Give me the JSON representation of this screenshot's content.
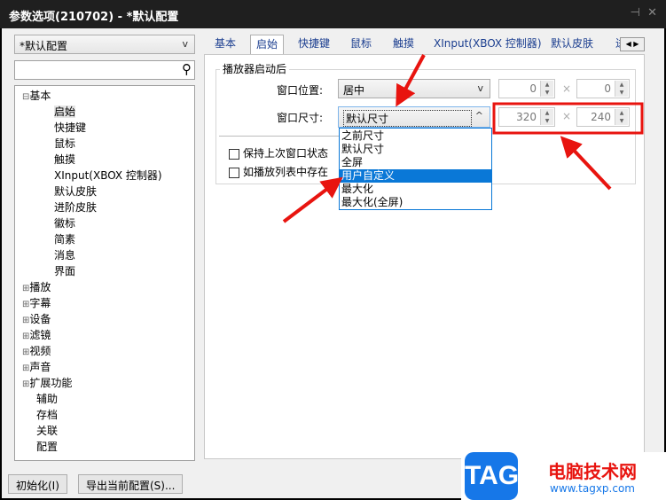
{
  "window": {
    "title": "参数选项(210702) - *默认配置",
    "pin_icon": "pin-icon",
    "close_icon": "close-icon"
  },
  "profile": {
    "selected": "*默认配置",
    "caret": "v"
  },
  "search": {
    "value": "",
    "icon": "search-icon"
  },
  "tree": [
    {
      "label": "基本",
      "level": 0,
      "expander": "⊟"
    },
    {
      "label": "启始",
      "level": 1,
      "selected": true
    },
    {
      "label": "快捷键",
      "level": 1
    },
    {
      "label": "鼠标",
      "level": 1
    },
    {
      "label": "触摸",
      "level": 1
    },
    {
      "label": "XInput(XBOX 控制器)",
      "level": 1
    },
    {
      "label": "默认皮肤",
      "level": 1
    },
    {
      "label": "进阶皮肤",
      "level": 1
    },
    {
      "label": "徽标",
      "level": 1
    },
    {
      "label": "简素",
      "level": 1
    },
    {
      "label": "消息",
      "level": 1
    },
    {
      "label": "界面",
      "level": 1
    },
    {
      "label": "播放",
      "level": 0,
      "expander": "⊞"
    },
    {
      "label": "字幕",
      "level": 0,
      "expander": "⊞"
    },
    {
      "label": "设备",
      "level": 0,
      "expander": "⊞"
    },
    {
      "label": "滤镜",
      "level": 0,
      "expander": "⊞"
    },
    {
      "label": "视频",
      "level": 0,
      "expander": "⊞"
    },
    {
      "label": "声音",
      "level": 0,
      "expander": "⊞"
    },
    {
      "label": "扩展功能",
      "level": 0,
      "expander": "⊞"
    },
    {
      "label": "辅助",
      "level": 0
    },
    {
      "label": "存档",
      "level": 0
    },
    {
      "label": "关联",
      "level": 0
    },
    {
      "label": "配置",
      "level": 0
    }
  ],
  "tabs": [
    "基本",
    "启始",
    "快捷键",
    "鼠标",
    "触摸",
    "XInput(XBOX 控制器)",
    "默认皮肤",
    "进"
  ],
  "active_tab": "启始",
  "group": {
    "title": "播放器启动后",
    "position_label": "窗口位置:",
    "position_value": "居中",
    "pos_x": "0",
    "pos_y": "0",
    "size_label": "窗口尺寸:",
    "size_value": "默认尺寸",
    "size_caret": "^",
    "size_w": "320",
    "size_h": "240",
    "times": "×",
    "checkbox1": "保持上次窗口状态",
    "checkbox2": "如播放列表中存在"
  },
  "dropdown": {
    "options": [
      "之前尺寸",
      "默认尺寸",
      "全屏",
      "用户自定义",
      "最大化",
      "最大化(全屏)"
    ],
    "highlighted": "用户自定义"
  },
  "buttons": {
    "reset": "初始化(I)",
    "export": "导出当前配置(S)..."
  },
  "watermark": {
    "logo": "TAG",
    "site": "电脑技术网",
    "url": "www.tagxp.com"
  },
  "colors": {
    "accent": "#0a78d7",
    "annotation": "#e8140f",
    "titlebar": "#1f1f1f"
  }
}
